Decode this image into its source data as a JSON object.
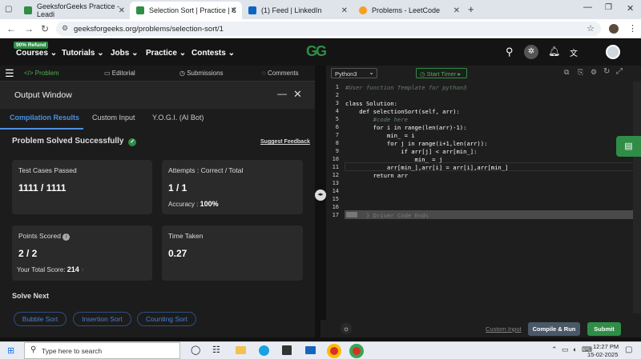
{
  "browser": {
    "tabs": [
      {
        "label": "GeeksforGeeks Practice - Leadi",
        "active": false
      },
      {
        "label": "Selection Sort | Practice | Geek",
        "active": true
      },
      {
        "label": "(1) Feed | LinkedIn",
        "active": false
      },
      {
        "label": "Problems - LeetCode",
        "active": false
      }
    ],
    "url": "geeksforgeeks.org/problems/selection-sort/1"
  },
  "gfg_nav": {
    "badge": "90% Refund",
    "items": [
      "Courses",
      "Tutorials",
      "Jobs",
      "Practice",
      "Contests"
    ],
    "logo": "GG"
  },
  "problem_tabs": [
    "Problem",
    "Editorial",
    "Submissions",
    "Comments"
  ],
  "output": {
    "title": "Output Window",
    "tabs": [
      "Compilation Results",
      "Custom Input",
      "Y.O.G.I. (AI Bot)"
    ],
    "status": "Problem Solved Successfully",
    "suggest": "Suggest Feedback",
    "test_label": "Test Cases Passed",
    "test_value": "1111 / 1111",
    "attempts_label": "Attempts : Correct / Total",
    "attempts_value": "1 / 1",
    "accuracy_label": "Accuracy :",
    "accuracy_value": "100%",
    "points_label": "Points Scored",
    "points_value": "2 / 2",
    "total_label": "Your Total Score:",
    "total_value": "214",
    "time_label": "Time Taken",
    "time_value": "0.27",
    "solve_next": "Solve Next",
    "next": [
      "Bubble Sort",
      "Insertion Sort",
      "Counting Sort"
    ]
  },
  "editor": {
    "language": "Python3",
    "start_timer": "Start Timer",
    "lines": [
      "#User function Template for python3",
      "",
      "class Solution:",
      "    def selectionSort(self, arr):",
      "        #code here",
      "        for i in range(len(arr)-1):",
      "            min_ = i",
      "            for j in range(i+1,len(arr)):",
      "                if arr[j] < arr[min_]:",
      "                    min_ = j",
      "            arr[min_],arr[i] = arr[i],arr[min_]",
      "        return arr",
      "",
      "",
      "",
      "",
      "} Driver Code Ends"
    ],
    "line_numbers": [
      "1",
      "2",
      "3",
      "4",
      "5",
      "6",
      "7",
      "8",
      "9",
      "10",
      "11",
      "12",
      "13",
      "14",
      "15",
      "16",
      "17"
    ],
    "custom_input": "Custom Input",
    "compile": "Compile & Run",
    "submit": "Submit"
  },
  "taskbar": {
    "search": "Type here to search",
    "time": "12:27 PM",
    "date": "15-02-2025"
  }
}
